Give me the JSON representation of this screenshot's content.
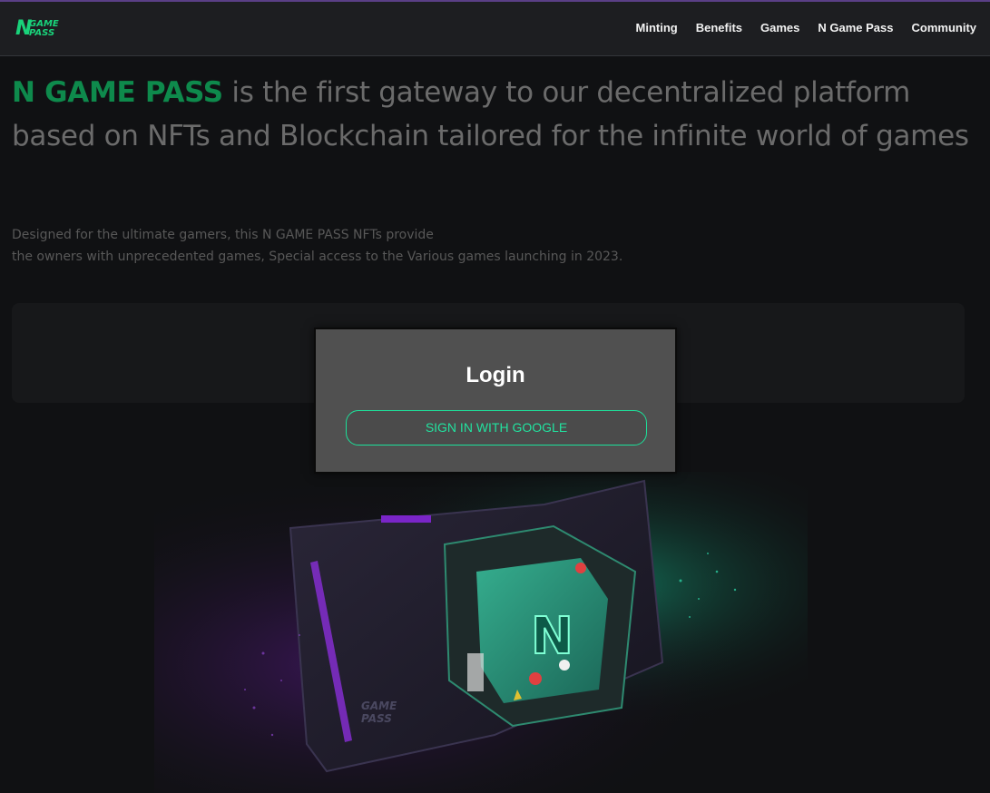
{
  "header": {
    "logo": {
      "letter": "N",
      "line1": "GAME",
      "line2": "PASS"
    },
    "nav": [
      "Minting",
      "Benefits",
      "Games",
      "N Game Pass",
      "Community"
    ]
  },
  "hero": {
    "brand": "N GAME PASS",
    "headline": " is the first gateway to our decentralized platform based on NFTs and Blockchain tailored for the infinite world of games",
    "sub_line1": "Designed for the ultimate gamers, this N GAME PASS NFTs provide",
    "sub_line2": "the owners with unprecedented games, Special access to the Various games launching in 2023."
  },
  "art": {
    "card_letter": "N",
    "card_brand_line1": "GAME",
    "card_brand_line2": "PASS"
  },
  "modal": {
    "title": "Login",
    "google_button": "SIGN IN WITH GOOGLE"
  },
  "colors": {
    "accent": "#19d27a",
    "brand_dim": "#0e8a4c",
    "modal_bg": "#505050",
    "button_border": "#1de19a"
  }
}
